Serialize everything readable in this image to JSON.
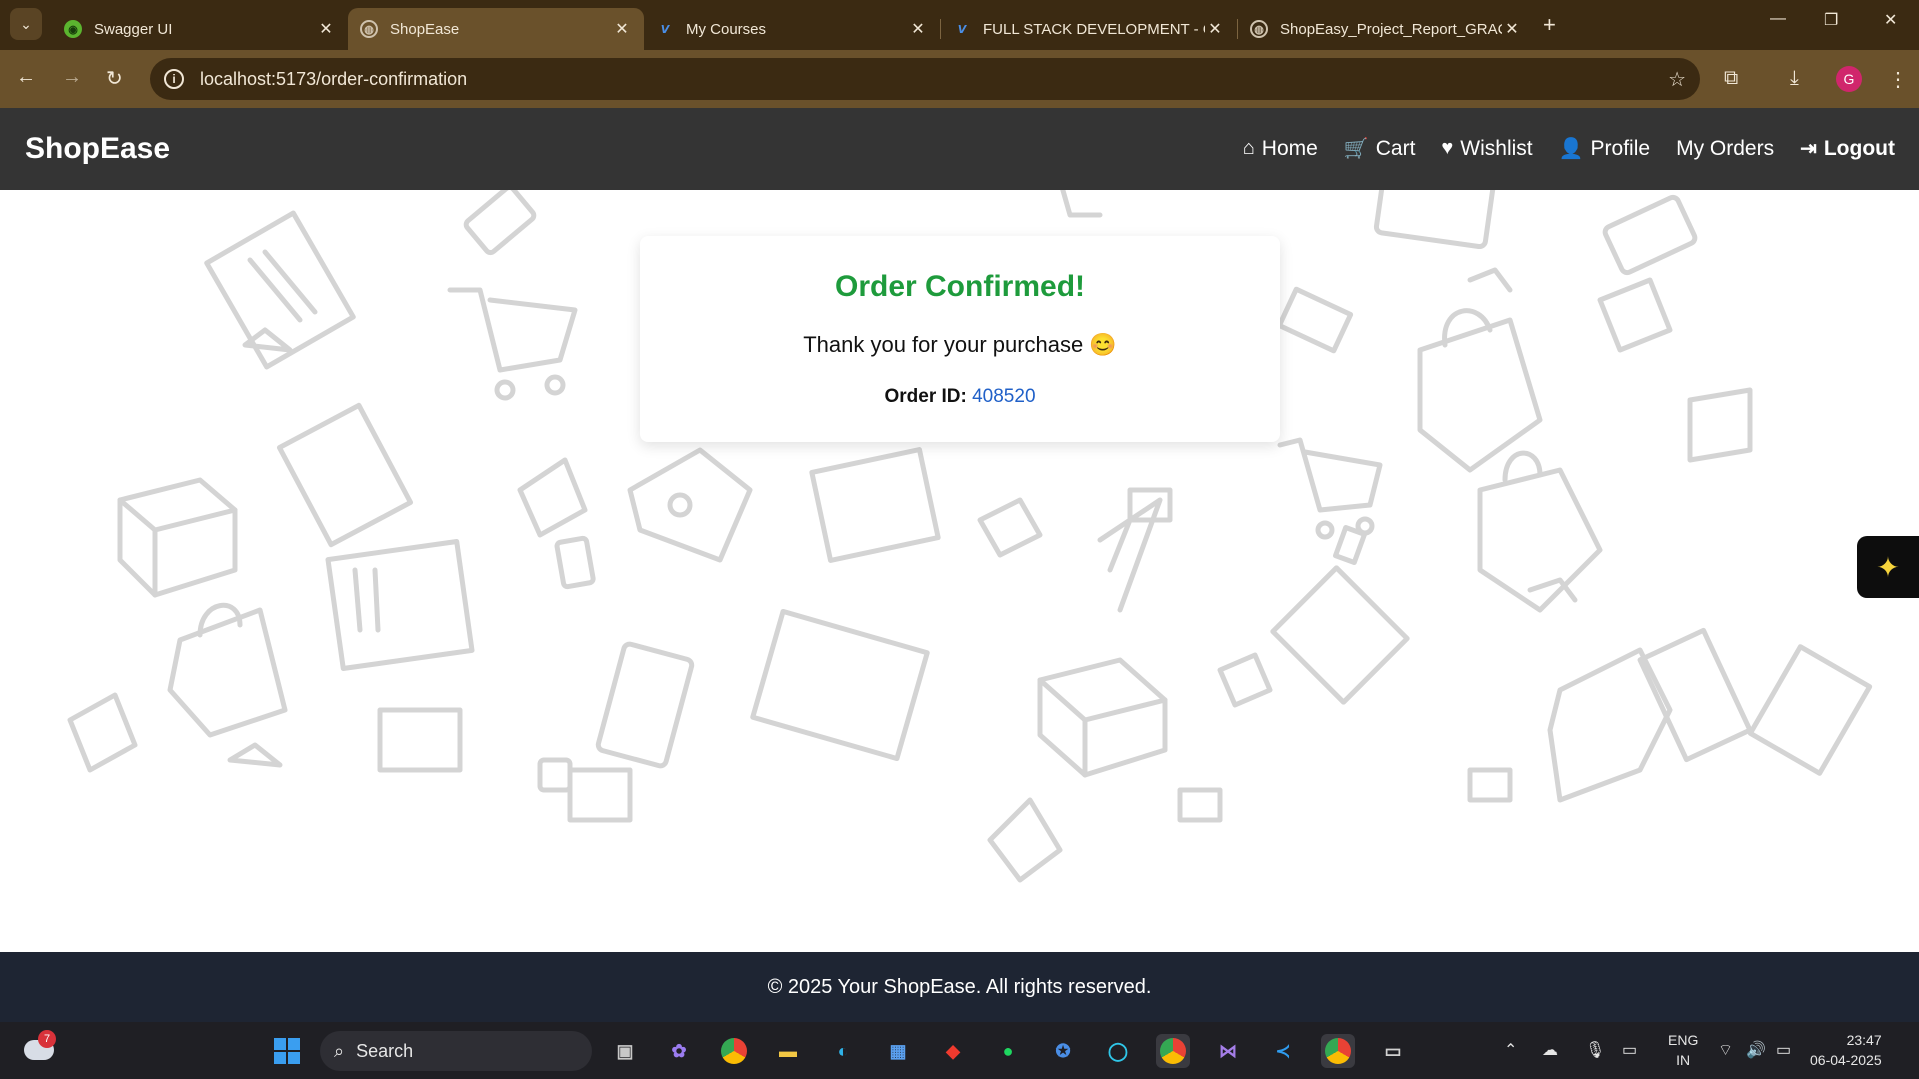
{
  "browser": {
    "tabs": [
      {
        "title": "Swagger UI",
        "icon": "swagger-icon",
        "active": false
      },
      {
        "title": "ShopEase",
        "icon": "globe-icon",
        "active": true
      },
      {
        "title": "My Courses",
        "icon": "courses-icon",
        "active": false
      },
      {
        "title": "FULL STACK DEVELOPMENT - C",
        "icon": "courses-icon",
        "active": false
      },
      {
        "title": "ShopEasy_Project_Report_GRAC",
        "icon": "globe-icon",
        "active": false
      }
    ],
    "url": "localhost:5173/order-confirmation",
    "profile_initial": "G"
  },
  "header": {
    "brand": "ShopEase",
    "nav": [
      {
        "label": "Home",
        "icon": "home-icon"
      },
      {
        "label": "Cart",
        "icon": "cart-icon"
      },
      {
        "label": "Wishlist",
        "icon": "heart-icon"
      },
      {
        "label": "Profile",
        "icon": "user-icon"
      },
      {
        "label": "My Orders",
        "icon": ""
      },
      {
        "label": "Logout",
        "icon": "logout-icon"
      }
    ]
  },
  "confirmation": {
    "title": "Order Confirmed!",
    "message": "Thank you for your purchase 😊",
    "order_id_label": "Order ID:",
    "order_id": "408520",
    "title_color": "#1e9b3c",
    "id_color": "#2060c8"
  },
  "footer": {
    "text": "© 2025 Your ShopEase. All rights reserved."
  },
  "taskbar": {
    "search_placeholder": "Search",
    "weather_badge": "7",
    "language": "ENG",
    "region": "IN",
    "time": "23:47",
    "date": "06-04-2025"
  }
}
